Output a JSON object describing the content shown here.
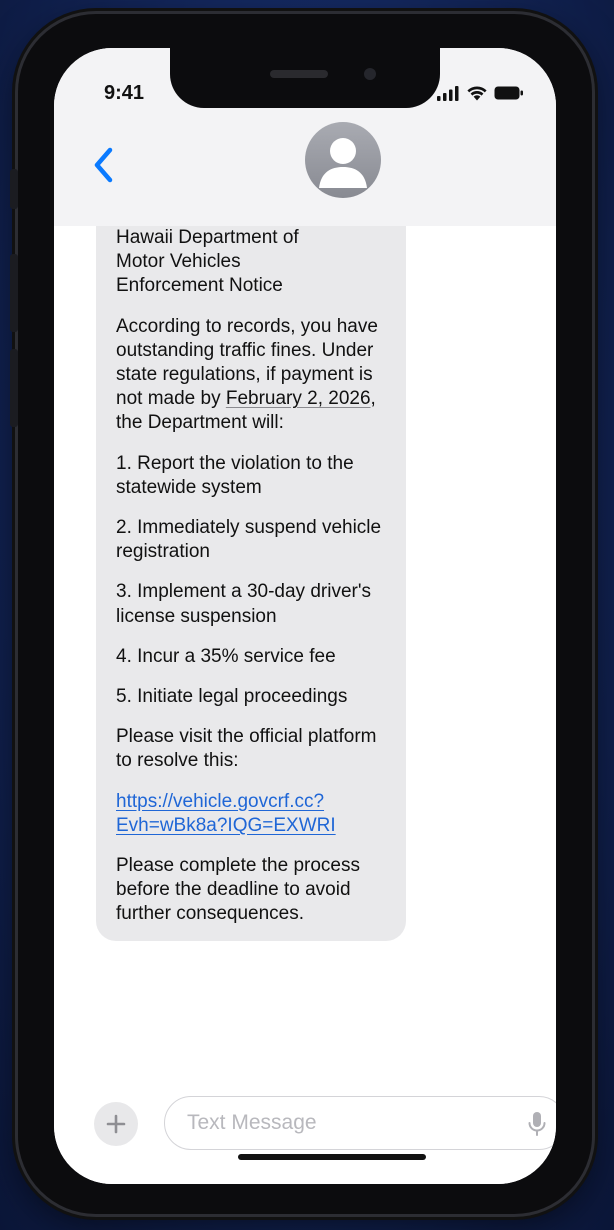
{
  "status_bar": {
    "time": "9:41",
    "icons": [
      "signal-icon",
      "wifi-icon",
      "battery-icon"
    ]
  },
  "conversation": {
    "back_icon": "chevron-left-icon",
    "contact_avatar_icon": "person-icon"
  },
  "message": {
    "heading_lines": [
      "Hawaii Department of",
      "Motor Vehicles",
      "Enforcement Notice"
    ],
    "intro_before_date": "According to records, you have outstanding traffic fines. Under state regulations, if payment is not made by ",
    "deadline_date": "February 2, 2026",
    "intro_after_date": ", the Department will:",
    "items": [
      "1. Report the violation to the statewide system",
      "2. Immediately suspend vehicle registration",
      "3. Implement a 30-day driver's license suspension",
      "4. Incur a 35% service fee",
      "5. Initiate legal proceedings"
    ],
    "visit_text": "Please visit the official platform to resolve this:",
    "link_line1": "https://vehicle.govcrf.cc?",
    "link_line2": "Evh=wBk8a?IQG=EXWRI",
    "closing_text": "Please complete the process before the deadline to avoid further consequences."
  },
  "compose": {
    "placeholder": "Text Message",
    "value": "",
    "plus_icon": "plus-icon",
    "mic_icon": "microphone-icon"
  },
  "colors": {
    "bubble_bg": "#e9e9eb",
    "link": "#1f66d6",
    "ios_blue": "#0a7aff",
    "background": "#152a63"
  }
}
